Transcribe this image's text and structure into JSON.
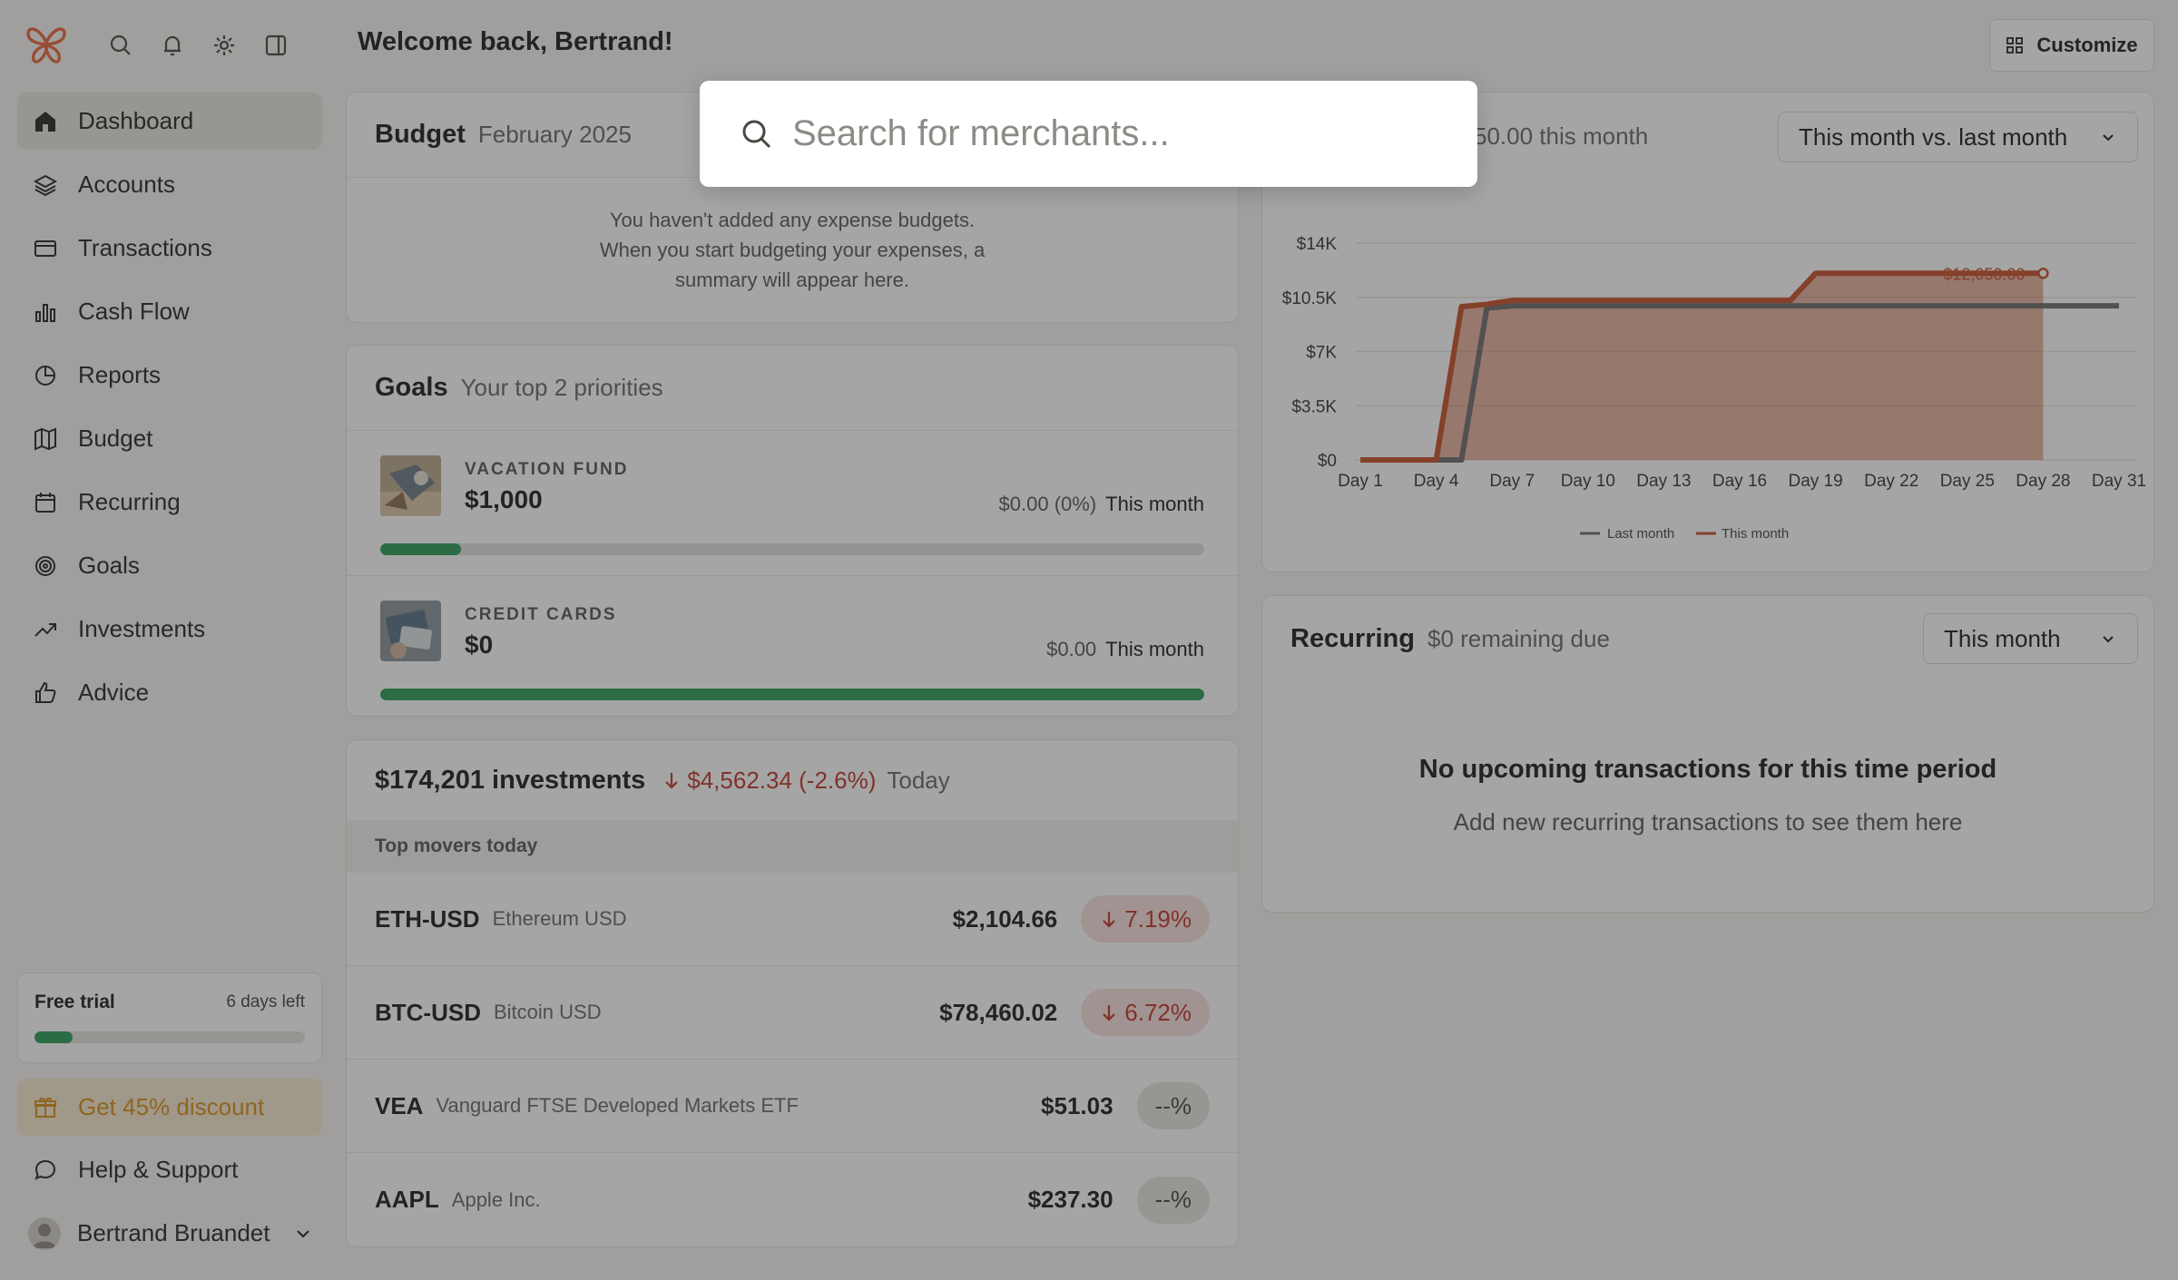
{
  "header": {
    "welcome": "Welcome back, Bertrand!",
    "customize_label": "Customize"
  },
  "sidebar": {
    "top_icons": [
      "search-icon",
      "bell-icon",
      "gear-icon",
      "sidebar-toggle-icon"
    ],
    "items": [
      {
        "label": "Dashboard",
        "icon": "home-icon",
        "active": true
      },
      {
        "label": "Accounts",
        "icon": "layers-icon"
      },
      {
        "label": "Transactions",
        "icon": "credit-card-icon"
      },
      {
        "label": "Cash Flow",
        "icon": "bar-chart-icon"
      },
      {
        "label": "Reports",
        "icon": "pie-chart-icon"
      },
      {
        "label": "Budget",
        "icon": "map-icon"
      },
      {
        "label": "Recurring",
        "icon": "calendar-icon"
      },
      {
        "label": "Goals",
        "icon": "target-icon"
      },
      {
        "label": "Investments",
        "icon": "trending-up-icon"
      },
      {
        "label": "Advice",
        "icon": "thumbs-up-icon"
      }
    ],
    "trial": {
      "title": "Free trial",
      "days_left": "6 days left",
      "progress": 0.14
    },
    "discount_label": "Get 45% discount",
    "help_label": "Help & Support",
    "user_name": "Bertrand Bruandet"
  },
  "budget": {
    "title": "Budget",
    "subtitle": "February 2025",
    "empty_line1": "You haven't added any expense budgets.",
    "empty_line2": "When you start budgeting your expenses, a",
    "empty_line3": "summary will appear here."
  },
  "goals": {
    "title": "Goals",
    "subtitle": "Your top 2 priorities",
    "items": [
      {
        "label": "VACATION FUND",
        "amount": "$1,000",
        "progress_text": "$0.00 (0%)",
        "period": "This month",
        "progress": 0.098
      },
      {
        "label": "CREDIT CARDS",
        "amount": "$0",
        "progress_text": "$0.00",
        "period": "This month",
        "progress": 1.0
      }
    ]
  },
  "investments": {
    "total": "$174,201 investments",
    "change": "$4,562.34 (-2.6%)",
    "period": "Today",
    "movers_label": "Top movers today",
    "movers": [
      {
        "symbol": "ETH-USD",
        "name": "Ethereum USD",
        "price": "$2,104.66",
        "change": "7.19%",
        "direction": "down"
      },
      {
        "symbol": "BTC-USD",
        "name": "Bitcoin USD",
        "price": "$78,460.02",
        "change": "6.72%",
        "direction": "down"
      },
      {
        "symbol": "VEA",
        "name": "Vanguard FTSE Developed Markets ETF",
        "price": "$51.03",
        "change": "--%",
        "direction": "flat"
      },
      {
        "symbol": "AAPL",
        "name": "Apple Inc.",
        "price": "$237.30",
        "change": "--%",
        "direction": "flat"
      }
    ]
  },
  "spending": {
    "header_value": "50.00 this month",
    "dropdown": "This month vs. last month",
    "point_label": "$12,050.00"
  },
  "recurring": {
    "title": "Recurring",
    "subtitle": "$0 remaining due",
    "dropdown": "This month",
    "empty_title": "No upcoming transactions for this time period",
    "empty_sub": "Add new recurring transactions to see them here"
  },
  "search": {
    "placeholder": "Search for merchants...",
    "value": ""
  },
  "chart_data": {
    "type": "area",
    "x": [
      1,
      2,
      3,
      4,
      5,
      6,
      7,
      8,
      9,
      10,
      11,
      12,
      13,
      14,
      15,
      16,
      17,
      18,
      19,
      20,
      21,
      22,
      23,
      24,
      25,
      26,
      27,
      28,
      29,
      30,
      31
    ],
    "x_ticks": [
      1,
      4,
      7,
      10,
      13,
      16,
      19,
      22,
      25,
      28,
      31
    ],
    "x_tick_labels": [
      "Day 1",
      "Day 4",
      "Day 7",
      "Day 10",
      "Day 13",
      "Day 16",
      "Day 19",
      "Day 22",
      "Day 25",
      "Day 28",
      "Day 31"
    ],
    "y_ticks": [
      0,
      3500,
      7000,
      10500,
      14000
    ],
    "y_tick_labels": [
      "$0",
      "$3.5K",
      "$7K",
      "$10.5K",
      "$14K"
    ],
    "ylim": [
      0,
      14000
    ],
    "grid": true,
    "legend": "bottom-center",
    "series": [
      {
        "name": "Last month",
        "color": "#6e6e6e",
        "values": [
          0,
          0,
          0,
          0,
          0,
          9800,
          9950,
          9950,
          9950,
          9950,
          9950,
          9950,
          9950,
          9950,
          9950,
          9950,
          9950,
          9950,
          9950,
          9950,
          9950,
          9950,
          9950,
          9950,
          9950,
          9950,
          9950,
          9950,
          9950,
          9950,
          9950
        ]
      },
      {
        "name": "This month",
        "color": "#c8512b",
        "values": [
          0,
          0,
          0,
          0,
          9900,
          10050,
          10300,
          10300,
          10300,
          10300,
          10300,
          10300,
          10300,
          10300,
          10300,
          10300,
          10300,
          10300,
          12050,
          12050,
          12050,
          12050,
          12050,
          12050,
          12050,
          12050,
          12050,
          12050
        ]
      }
    ]
  }
}
